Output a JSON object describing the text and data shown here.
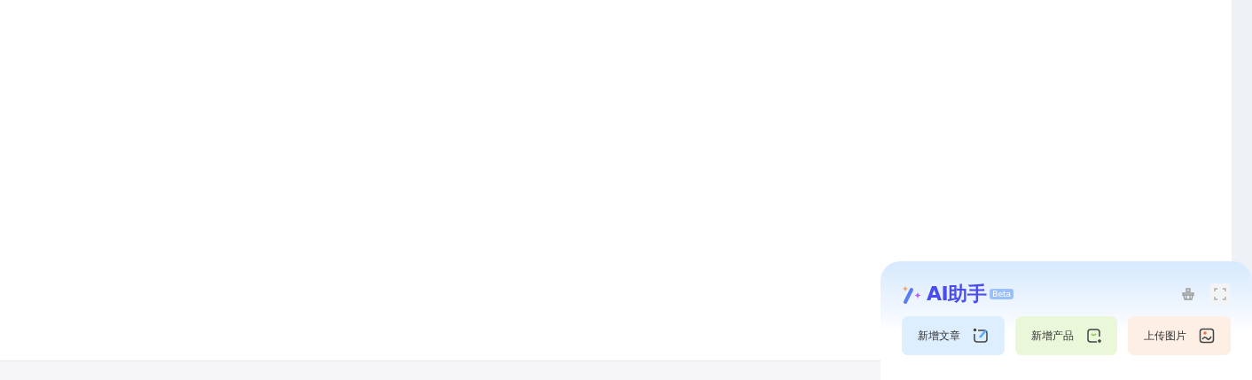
{
  "assistant": {
    "title": "AI助手",
    "badge": "Beta",
    "actions": [
      {
        "label": "新增文章",
        "kind": "article",
        "color": "#ddeefe"
      },
      {
        "label": "新增产品",
        "kind": "product",
        "color": "#eaf8d9"
      },
      {
        "label": "上传图片",
        "kind": "image",
        "color": "#fdefe4"
      }
    ]
  }
}
